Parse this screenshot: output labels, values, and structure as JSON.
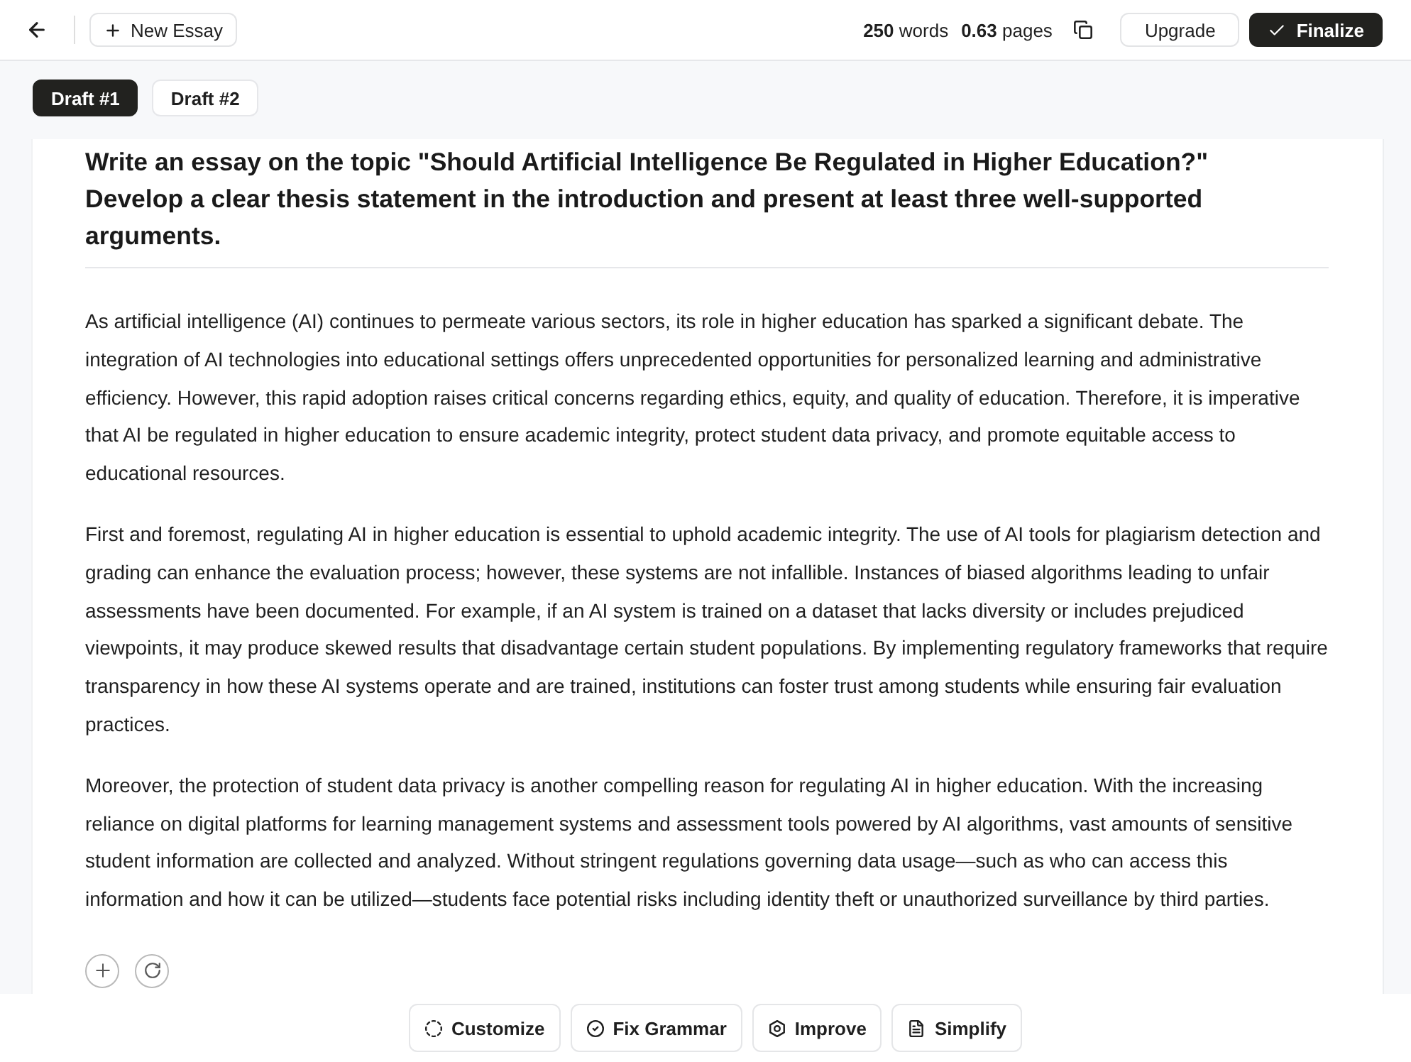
{
  "top_bar": {
    "new_button": "New Essay",
    "stats": [
      {
        "value": "250",
        "unit": "words"
      },
      {
        "value": "0.63",
        "unit": "pages"
      }
    ],
    "buttons": [
      {
        "label": "Upgrade",
        "kind": "outline"
      },
      {
        "label": "Finalize",
        "kind": "primary"
      }
    ]
  },
  "drafts": [
    {
      "label": "Draft #1",
      "selected": true
    },
    {
      "label": "Draft #2",
      "selected": false
    }
  ],
  "essay": {
    "prompt": "Write an essay on the topic \"Should Artificial Intelligence Be Regulated in Higher Education?\" Develop a clear thesis statement in the introduction and present at least three well-supported arguments.",
    "paragraphs": [
      "As artificial intelligence (AI) continues to permeate various sectors, its role in higher education has sparked a significant debate. The integration of AI technologies into educational settings offers unprecedented opportunities for personalized learning and administrative efficiency. However, this rapid adoption raises critical concerns regarding ethics, equity, and quality of education. Therefore, it is imperative that AI be regulated in higher education to ensure academic integrity, protect student data privacy, and promote equitable access to educational resources.",
      "First and foremost, regulating AI in higher education is essential to uphold academic integrity. The use of AI tools for plagiarism detection and grading can enhance the evaluation process; however, these systems are not infallible. Instances of biased algorithms leading to unfair assessments have been documented. For example, if an AI system is trained on a dataset that lacks diversity or includes prejudiced viewpoints, it may produce skewed results that disadvantage certain student populations. By implementing regulatory frameworks that require transparency in how these AI systems operate and are trained, institutions can foster trust among students while ensuring fair evaluation practices.",
      "Moreover, the protection of student data privacy is another compelling reason for regulating AI in higher education. With the increasing reliance on digital platforms for learning management systems and assessment tools powered by AI algorithms, vast amounts of sensitive student information are collected and analyzed. Without stringent regulations governing data usage—such as who can access this information and how it can be utilized—students face potential risks including identity theft or unauthorized surveillance by third parties."
    ]
  },
  "actions": [
    {
      "label": "Customize",
      "kind": "customize"
    },
    {
      "label": "Fix Grammar",
      "kind": "grammar"
    },
    {
      "label": "Improve",
      "kind": "improve"
    },
    {
      "label": "Simplify",
      "kind": "simplify"
    }
  ]
}
